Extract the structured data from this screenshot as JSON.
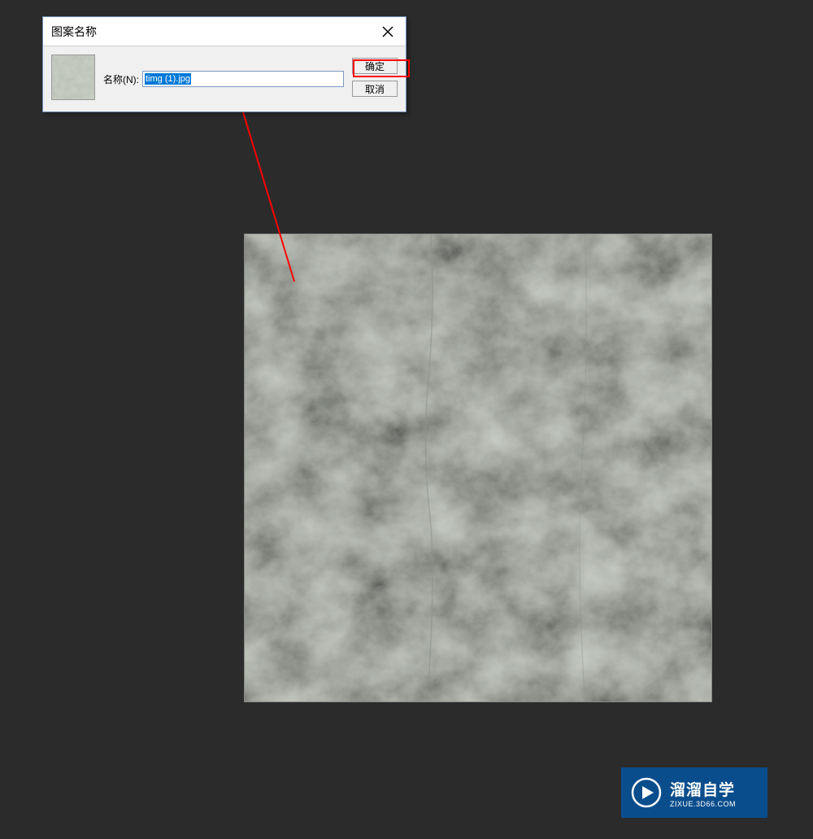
{
  "dialog": {
    "title": "图案名称",
    "name_label": "名称(N):",
    "name_value": "timg (1).jpg",
    "ok_label": "确定",
    "cancel_label": "取消"
  },
  "watermark": {
    "main_text": "溜溜自学",
    "sub_text": "ZIXUE.3D66.COM"
  },
  "highlight": {
    "ok_button": true
  },
  "colors": {
    "background": "#2b2b2b",
    "dialog_bg": "#f0f0f0",
    "dialog_border": "#6a8bb5",
    "selection": "#0078d7",
    "highlight": "#ff0000",
    "watermark_bg": "#0a4d8c",
    "texture": "#aeb5a8"
  }
}
